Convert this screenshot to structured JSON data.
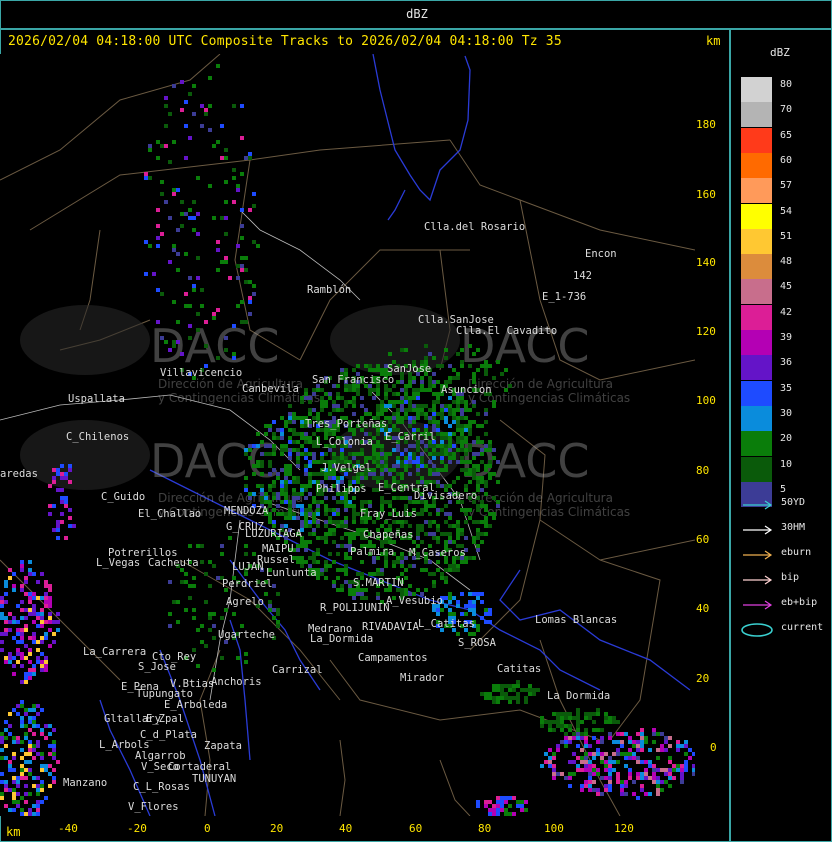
{
  "window": {
    "title": "dBZ"
  },
  "header": {
    "text": "2026/02/04 04:18:00 UTC Composite Tracks to 2026/02/04 04:18:00 Tz 35",
    "unit_top": "km",
    "unit_bottom": "km"
  },
  "axes": {
    "x_ticks": [
      "-40",
      "-20",
      "0",
      "20",
      "40",
      "60",
      "80",
      "100",
      "120"
    ],
    "y_ticks": [
      "180",
      "160",
      "140",
      "120",
      "100",
      "80",
      "60",
      "40",
      "20",
      "0"
    ],
    "x_range_km": [
      -60,
      142
    ],
    "y_range_km": [
      -20,
      200
    ]
  },
  "legend": {
    "title": "dBZ",
    "levels": [
      {
        "label": "80",
        "color": "#d2d2d2"
      },
      {
        "label": "70",
        "color": "#b4b4b4"
      },
      {
        "label": "65",
        "color": "#ff3a1a"
      },
      {
        "label": "60",
        "color": "#ff6a00"
      },
      {
        "label": "57",
        "color": "#ff9a5a"
      },
      {
        "label": "54",
        "color": "#ffff00"
      },
      {
        "label": "51",
        "color": "#ffc832"
      },
      {
        "label": "48",
        "color": "#dc8c3c"
      },
      {
        "label": "45",
        "color": "#c86e8c"
      },
      {
        "label": "42",
        "color": "#dc1e96"
      },
      {
        "label": "39",
        "color": "#b400b4"
      },
      {
        "label": "36",
        "color": "#6414c8"
      },
      {
        "label": "35",
        "color": "#1e4bff"
      },
      {
        "label": "30",
        "color": "#0a8cdc"
      },
      {
        "label": "20",
        "color": "#0a7d0a"
      },
      {
        "label": "10",
        "color": "#0a5a0a"
      },
      {
        "label": "5",
        "color": "#3c3c96"
      }
    ]
  },
  "tracks": [
    {
      "label": "50YD",
      "color": "#3ad0d0"
    },
    {
      "label": "30HM",
      "color": "#ffffff"
    },
    {
      "label": "eburn",
      "color": "#f0b050"
    },
    {
      "label": "bip",
      "color": "#ffd2d2"
    },
    {
      "label": "eb+bip",
      "color": "#e040e0"
    },
    {
      "label": "current",
      "color": "#3ad0d0"
    }
  ],
  "watermark": {
    "brand": "DACC",
    "line1": "Dirección de Agricultura",
    "line2": "y Contingencias Climáticas"
  },
  "places": [
    {
      "name": "Clla.del Rosario"
    },
    {
      "name": "Encon"
    },
    {
      "name": "E_1-736"
    },
    {
      "name": "142"
    },
    {
      "name": "Ramblón"
    },
    {
      "name": "Clla.SanJose"
    },
    {
      "name": "Clla.El Cavadito"
    },
    {
      "name": "Villavicencio"
    },
    {
      "name": "Canbevila"
    },
    {
      "name": "Uspallata"
    },
    {
      "name": "C_Chilenos"
    },
    {
      "name": "aredas"
    },
    {
      "name": "C_Guido"
    },
    {
      "name": "El_Challao"
    },
    {
      "name": "MENDOZA"
    },
    {
      "name": "G_CRUZ"
    },
    {
      "name": "LUZURIAGA"
    },
    {
      "name": "MAIPU"
    },
    {
      "name": "Russel"
    },
    {
      "name": "LUJAN"
    },
    {
      "name": "Lunlunta"
    },
    {
      "name": "Perdriel"
    },
    {
      "name": "Agrelo"
    },
    {
      "name": "Potrerillos"
    },
    {
      "name": "L_Vegas"
    },
    {
      "name": "Cacheuta"
    },
    {
      "name": "San Francisco"
    },
    {
      "name": "SanJose"
    },
    {
      "name": "Asuncion"
    },
    {
      "name": "Tres_Porteñas"
    },
    {
      "name": "E_Carril"
    },
    {
      "name": "L_Colonia"
    },
    {
      "name": "J.Velgel"
    },
    {
      "name": "E_Central"
    },
    {
      "name": "Divisadero"
    },
    {
      "name": "Philipps"
    },
    {
      "name": "Fray_Luis"
    },
    {
      "name": "Chapeñas"
    },
    {
      "name": "Palmira"
    },
    {
      "name": "M_Caseros"
    },
    {
      "name": "S.MARTIN"
    },
    {
      "name": "A_Vesubio"
    },
    {
      "name": "R_POLIJUNIN"
    },
    {
      "name": "RIVADAVIA"
    },
    {
      "name": "Medrano"
    },
    {
      "name": "L_Catitas"
    },
    {
      "name": "La_Dormida"
    },
    {
      "name": "S_ROSA"
    },
    {
      "name": "Lomas Blancas"
    },
    {
      "name": "Catitas"
    },
    {
      "name": "La Dormida"
    },
    {
      "name": "Campamentos"
    },
    {
      "name": "Mirador"
    },
    {
      "name": "Ugarteche"
    },
    {
      "name": "Carrizal"
    },
    {
      "name": "La_Carrera"
    },
    {
      "name": "Cto_Rey"
    },
    {
      "name": "S_Jose"
    },
    {
      "name": "E_Pena"
    },
    {
      "name": "Tupungato"
    },
    {
      "name": "V.Btias"
    },
    {
      "name": "Anchoris"
    },
    {
      "name": "E_Zpal"
    },
    {
      "name": "E_Arboleda"
    },
    {
      "name": "Gltallary"
    },
    {
      "name": "L_Arbols"
    },
    {
      "name": "Zapata"
    },
    {
      "name": "Manzano"
    },
    {
      "name": "Algarrob"
    },
    {
      "name": "V_Seco"
    },
    {
      "name": "Cortaderal"
    },
    {
      "name": "C_L_Rosas"
    },
    {
      "name": "TUNUYAN"
    },
    {
      "name": "V_Flores"
    },
    {
      "name": "C_d_Plata"
    }
  ]
}
